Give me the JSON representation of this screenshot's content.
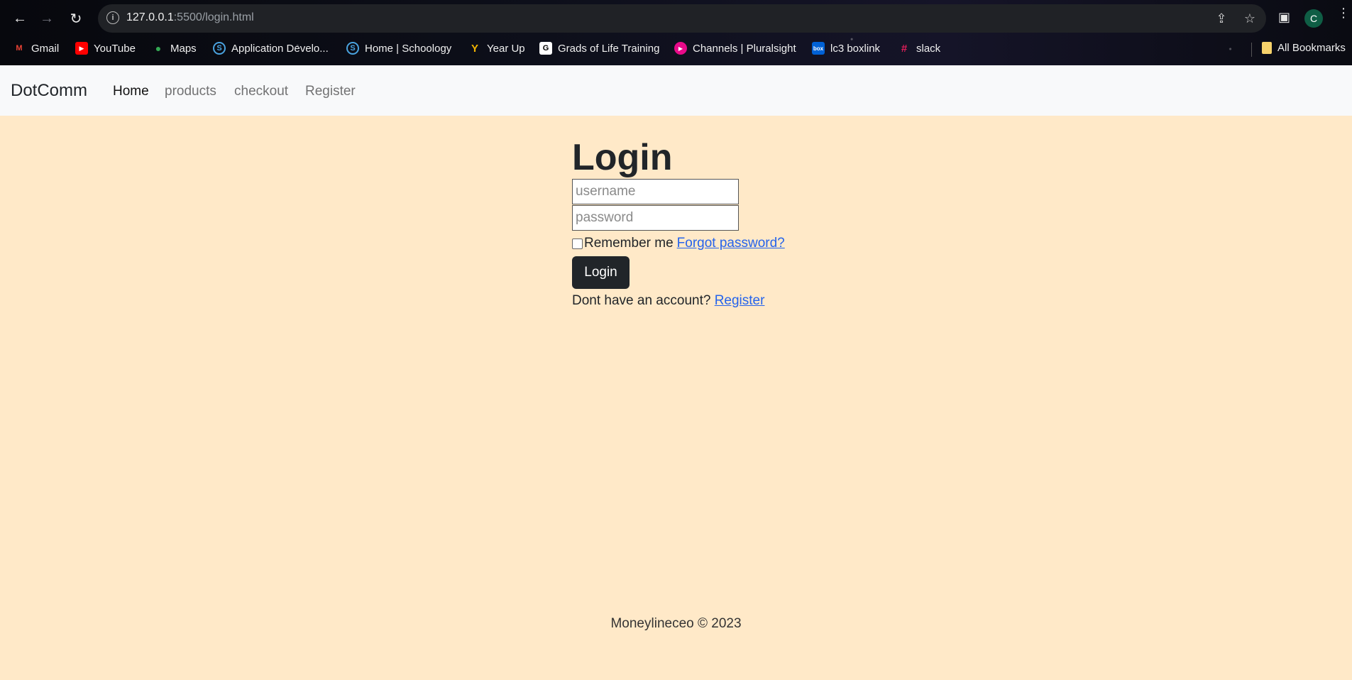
{
  "browser": {
    "url_host": "127.0.0.1",
    "url_path": ":5500/login.html",
    "avatar_letter": "C",
    "bookmarks": [
      {
        "label": "Gmail",
        "icon": "gmail-icon",
        "color": "#ea4335",
        "glyph": "M"
      },
      {
        "label": "YouTube",
        "icon": "youtube-icon",
        "color": "#ff0000",
        "glyph": "▶"
      },
      {
        "label": "Maps",
        "icon": "maps-icon",
        "color": "#34a853",
        "glyph": "●"
      },
      {
        "label": "Application Develo...",
        "icon": "schoology-icon",
        "color": "#4aa3df",
        "glyph": "S"
      },
      {
        "label": "Home | Schoology",
        "icon": "schoology-icon",
        "color": "#4aa3df",
        "glyph": "S"
      },
      {
        "label": "Year Up",
        "icon": "yearup-icon",
        "color": "#f2b400",
        "glyph": "Y"
      },
      {
        "label": "Grads of Life Training",
        "icon": "grads-of-life-icon",
        "color": "#ffffff",
        "glyph": "G"
      },
      {
        "label": "Channels | Pluralsight",
        "icon": "pluralsight-icon",
        "color": "#e80a89",
        "glyph": "▶"
      },
      {
        "label": "lc3 boxlink",
        "icon": "box-icon",
        "color": "#0061d5",
        "glyph": "box"
      },
      {
        "label": "slack",
        "icon": "slack-icon",
        "color": "#e01e5a",
        "glyph": "#"
      }
    ],
    "all_bookmarks_label": "All Bookmarks"
  },
  "nav": {
    "brand": "DotComm",
    "links": [
      "Home",
      "products",
      "checkout",
      "Register"
    ]
  },
  "login": {
    "title": "Login",
    "username_placeholder": "username",
    "password_placeholder": "password",
    "remember_label": "Remember me",
    "forgot_label": "Forgot password?",
    "button_label": "Login",
    "no_account_text": "Dont have an account?",
    "register_link": "Register"
  },
  "footer": {
    "text": "Moneylineceo © 2023"
  }
}
